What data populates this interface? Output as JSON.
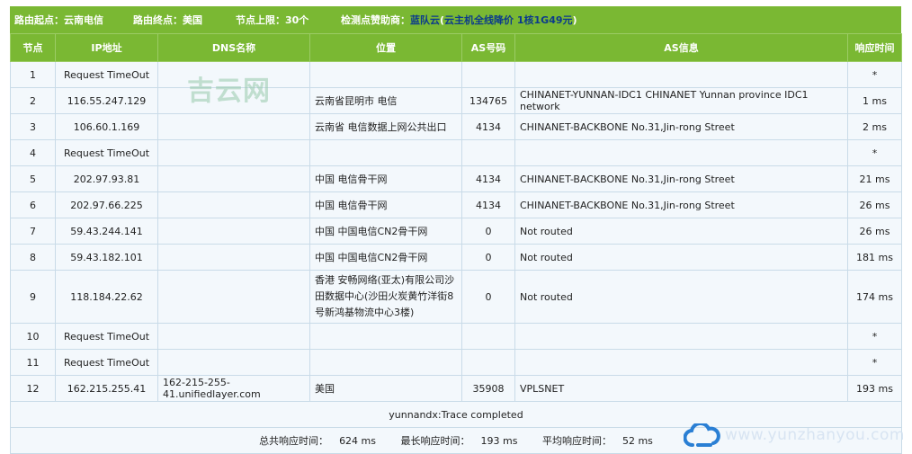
{
  "topbar": {
    "segments": [
      {
        "label": "路由起点：",
        "value": "云南电信"
      },
      {
        "label": "路由终点：",
        "value": "美国"
      },
      {
        "label": "节点上限：",
        "value": "30个"
      },
      {
        "label": "检测点赞助商：",
        "value": "蓝队云"
      }
    ],
    "sponsor_promo_open": "(",
    "sponsor_promo": "云主机全线降价 1核1G49元",
    "sponsor_promo_close": ")"
  },
  "columns": [
    "节点",
    "IP地址",
    "DNS名称",
    "位置",
    "AS号码",
    "AS信息",
    "响应时间"
  ],
  "hops": [
    {
      "node": "1",
      "ip": "Request TimeOut",
      "dns": "",
      "location": "",
      "as_number": "",
      "as_info": "",
      "response": "*"
    },
    {
      "node": "2",
      "ip": "116.55.247.129",
      "dns": "",
      "location": "云南省昆明市 电信",
      "as_number": "134765",
      "as_info": "CHINANET-YUNNAN-IDC1 CHINANET Yunnan province IDC1 network",
      "response": "1 ms"
    },
    {
      "node": "3",
      "ip": "106.60.1.169",
      "dns": "",
      "location": "云南省 电信数据上网公共出口",
      "as_number": "4134",
      "as_info": "CHINANET-BACKBONE No.31,Jin-rong Street",
      "response": "2 ms"
    },
    {
      "node": "4",
      "ip": "Request TimeOut",
      "dns": "",
      "location": "",
      "as_number": "",
      "as_info": "",
      "response": "*"
    },
    {
      "node": "5",
      "ip": "202.97.93.81",
      "dns": "",
      "location": "中国 电信骨干网",
      "as_number": "4134",
      "as_info": "CHINANET-BACKBONE No.31,Jin-rong Street",
      "response": "21 ms"
    },
    {
      "node": "6",
      "ip": "202.97.66.225",
      "dns": "",
      "location": "中国 电信骨干网",
      "as_number": "4134",
      "as_info": "CHINANET-BACKBONE No.31,Jin-rong Street",
      "response": "26 ms"
    },
    {
      "node": "7",
      "ip": "59.43.244.141",
      "dns": "",
      "location": "中国 中国电信CN2骨干网",
      "as_number": "0",
      "as_info": "Not routed",
      "response": "26 ms"
    },
    {
      "node": "8",
      "ip": "59.43.182.101",
      "dns": "",
      "location": "中国 中国电信CN2骨干网",
      "as_number": "0",
      "as_info": "Not routed",
      "response": "181 ms"
    },
    {
      "node": "9",
      "ip": "118.184.22.62",
      "dns": "",
      "location": "香港 安畅网络(亚太)有限公司沙田数据中心(沙田火炭黄竹洋街8号新鸿基物流中心3楼)",
      "as_number": "0",
      "as_info": "Not routed",
      "response": "174 ms"
    },
    {
      "node": "10",
      "ip": "Request TimeOut",
      "dns": "",
      "location": "",
      "as_number": "",
      "as_info": "",
      "response": "*"
    },
    {
      "node": "11",
      "ip": "Request TimeOut",
      "dns": "",
      "location": "",
      "as_number": "",
      "as_info": "",
      "response": "*"
    },
    {
      "node": "12",
      "ip": "162.215.255.41",
      "dns": "162-215-255-41.unifiedlayer.com",
      "location": "美国",
      "as_number": "35908",
      "as_info": "VPLSNET",
      "response": "193 ms"
    }
  ],
  "summary": {
    "trace_status": "yunnandx:Trace completed",
    "total_label": "总共响应时间：",
    "total_value": "624 ms",
    "max_label": "最长响应时间：",
    "max_value": "193 ms",
    "avg_label": "平均响应时间：",
    "avg_value": "52 ms"
  },
  "watermark": "吉云网",
  "brand": {
    "logo_icon": "cloud-logo-icon",
    "site_text": "www.yunzhanyou.com",
    "logo_color": "#2a7fd4"
  },
  "colors": {
    "header_green": "#7ab833",
    "row_bg": "#f3f8fc",
    "grid_line": "#c9dbe8",
    "sponsor_link": "#0b3a8c"
  }
}
